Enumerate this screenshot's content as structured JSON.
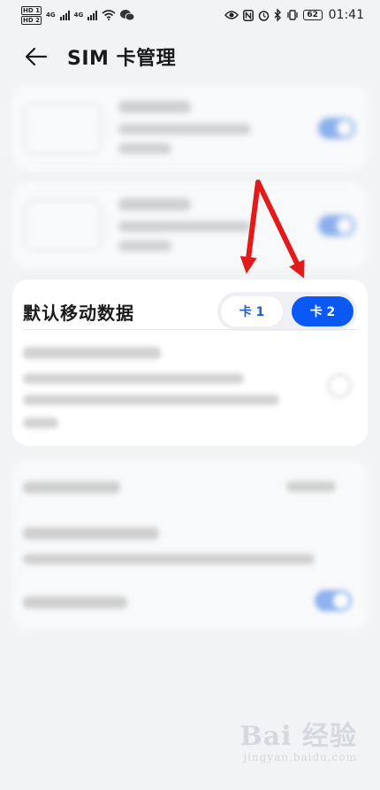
{
  "status_bar": {
    "left_tags": [
      "HD 1",
      "HD 2"
    ],
    "net1": "4G",
    "net2": "4G",
    "battery": "62",
    "time": "01:41"
  },
  "header": {
    "title": "SIM 卡管理"
  },
  "default_data": {
    "label": "默认移动数据",
    "option1": "卡 1",
    "option2": "卡 2",
    "selected": "卡 2"
  },
  "watermark": {
    "brand": "Bai 经验",
    "domain": "jingyan.baidu.com"
  },
  "colors": {
    "accent": "#0a59f7",
    "arrow": "#e31a1a",
    "background": "#f1f3f5"
  },
  "icons": [
    "back-arrow-icon",
    "eye-icon",
    "nfc-icon",
    "alarm-icon",
    "bluetooth-icon",
    "vibrate-icon",
    "wifi-icon",
    "wechat-icon"
  ]
}
